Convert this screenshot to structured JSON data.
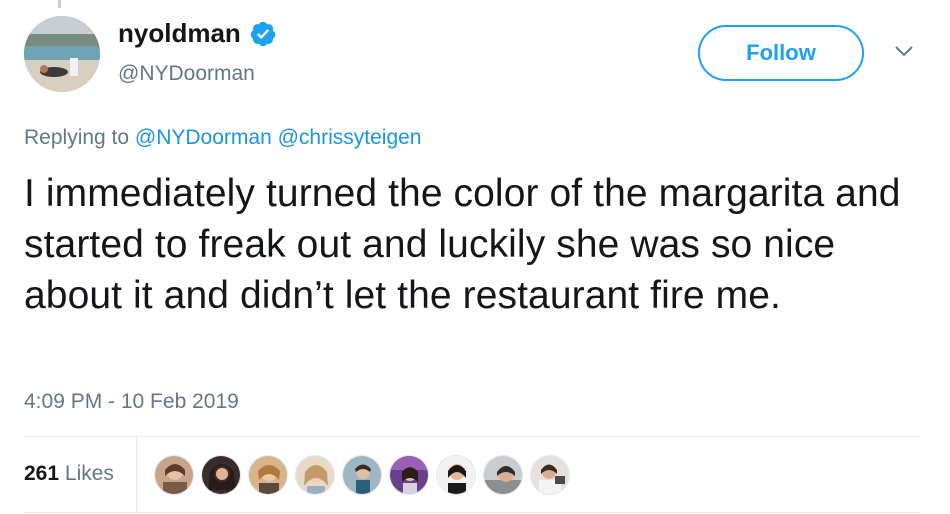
{
  "user": {
    "display_name": "nyoldman",
    "handle": "@NYDoorman",
    "verified_icon": "verified-badge-icon",
    "avatar_icon": "profile-photo-icon"
  },
  "follow_label": "Follow",
  "caret_icon": "chevron-down-icon",
  "reply": {
    "prefix": "Replying to",
    "mentions": [
      "@NYDoorman",
      "@chrissyteigen"
    ]
  },
  "tweet_text": "I immediately turned the color of the margarita and started to freak out and luckily she was so nice about it and didn’t let the restaurant fire me.",
  "timestamp": "4:09 PM - 10 Feb 2019",
  "likes": {
    "count": "261",
    "label": "Likes"
  },
  "colors": {
    "twitter_blue": "#1da1f2",
    "mention_blue": "#1b95e0",
    "secondary_text": "#657786",
    "primary_text": "#14171a",
    "divider": "#e6ecf0"
  }
}
